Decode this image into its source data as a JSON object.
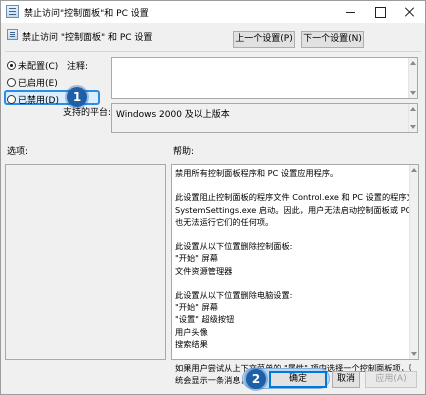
{
  "window": {
    "title": "禁止访问\"控制面板\"和 PC 设置",
    "controls": {
      "minimize": "minimize-icon",
      "maximize": "maximize-icon",
      "close": "close-icon"
    }
  },
  "header": {
    "setting_name": "禁止访问 \"控制面板\" 和 PC 设置",
    "prev_button": "上一个设置(P)",
    "next_button": "下一个设置(N)"
  },
  "state": {
    "options": [
      {
        "label": "未配置(C)",
        "selected": true
      },
      {
        "label": "已启用(E)",
        "selected": false
      },
      {
        "label": "已禁用(D)",
        "selected": false
      }
    ]
  },
  "comment": {
    "label": "注释:",
    "value": ""
  },
  "supported": {
    "label": "支持的平台:",
    "value": "Windows 2000 及以上版本"
  },
  "options_panel": {
    "label": "选项:"
  },
  "help": {
    "label": "帮助:",
    "lines": [
      "禁用所有控制面板程序和 PC 设置应用程序。",
      "",
      "此设置阻止控制面板的程序文件 Control.exe 和 PC 设置的程序文件",
      "SystemSettings.exe 启动。因此，用户无法启动控制面板或 PC 设置，",
      "也无法运行它们的任何项。",
      "",
      "此设置从以下位置删除控制面板:",
      "\"开始\" 屏幕",
      "文件资源管理器",
      "",
      "此设置从以下位置删除电脑设置:",
      "\"开始\" 屏幕",
      "\"设置\" 超级按钮",
      "用户头像",
      "搜索结果",
      "",
      "如果用户尝试从上下文菜单的 \"属性\" 项中选择一个控制面板项，则系",
      "统会显示一条消息，说明设置禁止该操作。"
    ]
  },
  "footer": {
    "ok_button": "确定",
    "cancel_button": "取消",
    "apply_button": "应用(A)"
  },
  "annotations": {
    "step1": "1",
    "step2": "2"
  },
  "colors": {
    "accent": "#0078d7",
    "badge": "#1f5fa8",
    "highlight": "#2b8de3"
  }
}
